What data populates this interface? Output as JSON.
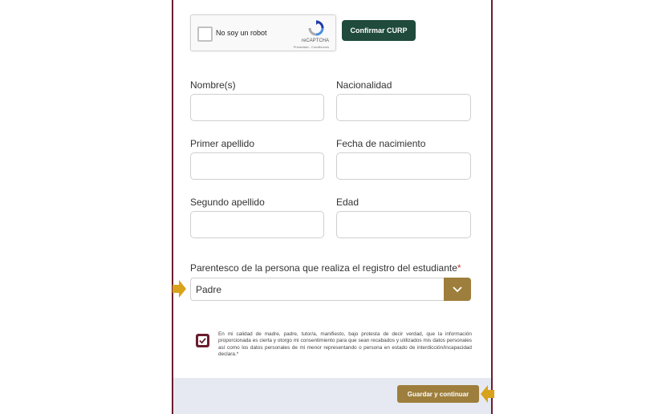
{
  "recaptcha": {
    "label": "No soy un robot",
    "brand": "reCAPTCHA",
    "terms": "Privacidad - Condiciones"
  },
  "buttons": {
    "confirm_curp": "Confirmar CURP",
    "save_continue": "Guardar y continuar"
  },
  "form": {
    "fields": {
      "nombre": {
        "label": "Nombre(s)",
        "value": ""
      },
      "nacionalidad": {
        "label": "Nacionalidad",
        "value": ""
      },
      "primer_apellido": {
        "label": "Primer apellido",
        "value": ""
      },
      "fecha_nacimiento": {
        "label": "Fecha de nacimiento",
        "value": ""
      },
      "segundo_apellido": {
        "label": "Segundo apellido",
        "value": ""
      },
      "edad": {
        "label": "Edad",
        "value": ""
      }
    },
    "parentesco": {
      "question": "Parentesco de la persona que realiza el registro del estudiante",
      "required_mark": "*",
      "selected": "Padre"
    },
    "consent": {
      "checked": true,
      "text": "En mi calidad de madre, padre, tutor/a, manifiesto, bajo protesta de decir verdad, que la información proporcionada es cierta y otorgo mi consentimiento para que sean recabados y utilizados mis datos personales así como los datos personales de mi menor representando o persona en estado de interdicción/incapacidad declara.*"
    }
  },
  "colors": {
    "curp_button": "#1f4a3c",
    "gold": "#9e7e3c",
    "maroon": "#6b1d2e",
    "arrow": "#d9a21b",
    "footer_bg": "#e6e9f1"
  },
  "icons": {
    "select_caret": "chevron-down-icon",
    "checkbox_mark": "checkmark-icon",
    "pointer_left": "arrow-right-icon",
    "pointer_right": "arrow-left-icon"
  }
}
